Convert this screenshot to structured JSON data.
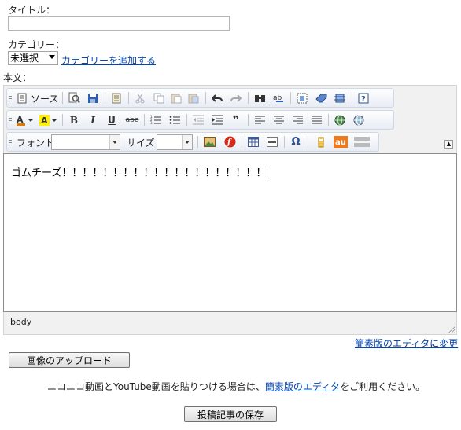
{
  "form": {
    "title_label": "タイトル：",
    "title_value": "",
    "category_label": "カテゴリー：",
    "category_selected": "未選択",
    "add_category_link": "カテゴリーを追加する",
    "body_label": "本文："
  },
  "toolbar": {
    "source_label": "ソース",
    "font_label": "フォント",
    "size_label": "サイズ",
    "font_value": "",
    "size_value": ""
  },
  "editor": {
    "content": "ゴムチーズ！！！！！！！！！！！！！！！！！！！！",
    "path": "body"
  },
  "links": {
    "switch_editor": "簡素版のエディタに変更"
  },
  "actions": {
    "upload_button": "画像のアップロード",
    "note_prefix": "ニコニコ動画とYouTube動画を貼りつける場合は、",
    "note_link": "簡素版のエディタ",
    "note_suffix": "をご利用ください。",
    "save_button": "投稿記事の保存"
  }
}
